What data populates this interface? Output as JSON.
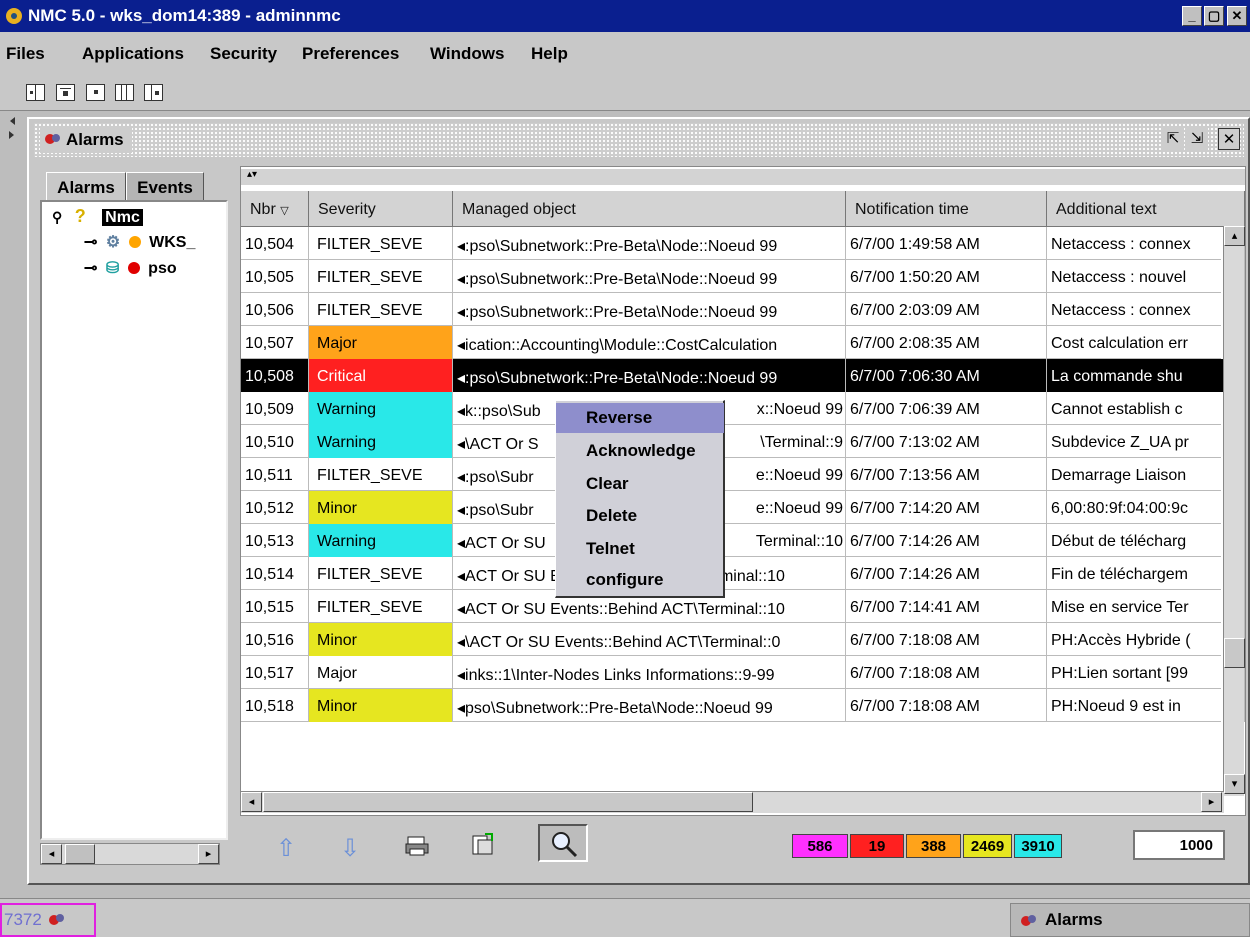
{
  "window": {
    "title": "NMC 5.0 - wks_dom14:389 - adminnmc",
    "controls": [
      "_",
      "▢",
      "✕"
    ]
  },
  "menu": [
    "Files",
    "Applications",
    "Security",
    "Preferences",
    "Windows",
    "Help"
  ],
  "frame": {
    "title": "Alarms"
  },
  "left_tabs": [
    "Alarms",
    "Events"
  ],
  "tree": [
    {
      "label": "Nmc",
      "color": "#000000"
    },
    {
      "label": "WKS_",
      "color": "#ffa500"
    },
    {
      "label": "pso",
      "color": "#e00000"
    }
  ],
  "table": {
    "columns": [
      "Nbr",
      "Severity",
      "Managed object",
      "Notification time",
      "Additional text"
    ],
    "rows": [
      [
        "10,504",
        "FILTER_SEVE",
        "◂:pso\\Subnetwork::Pre-Beta\\Node::Noeud 99",
        "6/7/00 1:49:58 AM",
        "Netaccess : connex"
      ],
      [
        "10,505",
        "FILTER_SEVE",
        "◂:pso\\Subnetwork::Pre-Beta\\Node::Noeud 99",
        "6/7/00 1:50:20 AM",
        "Netaccess : nouvel"
      ],
      [
        "10,506",
        "FILTER_SEVE",
        "◂:pso\\Subnetwork::Pre-Beta\\Node::Noeud 99",
        "6/7/00 2:03:09 AM",
        "Netaccess : connex"
      ],
      [
        "10,507",
        "Major",
        "◂ication::Accounting\\Module::CostCalculation",
        "6/7/00 2:08:35 AM",
        "Cost calculation err"
      ],
      [
        "10,508",
        "Critical",
        "◂:pso\\Subnetwork::Pre-Beta\\Node::Noeud 99",
        "6/7/00 7:06:30 AM",
        "La commande shu"
      ],
      [
        "10,509",
        "Warning",
        "◂k::pso\\Sub",
        "6/7/00 7:06:39 AM",
        "Cannot establish c"
      ],
      [
        "10,510",
        "Warning",
        "◂\\ACT Or S",
        "6/7/00 7:13:02 AM",
        "Subdevice Z_UA pr"
      ],
      [
        "10,511",
        "FILTER_SEVE",
        "◂:pso\\Subr",
        "6/7/00 7:13:56 AM",
        "Demarrage Liaison"
      ],
      [
        "10,512",
        "Minor",
        "◂:pso\\Subr",
        "6/7/00 7:14:20 AM",
        "6,00:80:9f:04:00:9c"
      ],
      [
        "10,513",
        "Warning",
        "◂ACT Or SU",
        "6/7/00 7:14:26 AM",
        "Début de télécharg"
      ],
      [
        "10,514",
        "FILTER_SEVE",
        "◂ACT Or SU Events::Behind ACT\\Terminal::10",
        "6/7/00 7:14:26 AM",
        "Fin de téléchargem"
      ],
      [
        "10,515",
        "FILTER_SEVE",
        "◂ACT Or SU Events::Behind ACT\\Terminal::10",
        "6/7/00 7:14:41 AM",
        "Mise en service Ter"
      ],
      [
        "10,516",
        "Minor",
        "◂\\ACT Or SU Events::Behind ACT\\Terminal::0",
        "6/7/00 7:18:08 AM",
        "PH:Accès Hybride ("
      ],
      [
        "10,517",
        "Major",
        "◂inks::1\\Inter-Nodes Links Informations::9-99",
        "6/7/00 7:18:08 AM",
        "PH:Lien sortant [99"
      ],
      [
        "10,518",
        "Minor",
        "◂pso\\Subnetwork::Pre-Beta\\Node::Noeud 99",
        "6/7/00 7:18:08 AM",
        "PH:Noeud 9 est in"
      ]
    ],
    "row_bg": [
      "",
      "",
      "",
      "#ffa31a",
      "#ff2020",
      "#29e8e8",
      "#29e8e8",
      "",
      "#e6e620",
      "#29e8e8",
      "",
      "",
      "#e6e620",
      "",
      "#e6e620"
    ],
    "selected_row": 4
  },
  "cell_tail": {
    "r5": "x::Noeud 99",
    "r6": "\\Terminal::9",
    "r7": "e::Noeud 99",
    "r8": "e::Noeud 99",
    "r9": "Terminal::10"
  },
  "context_menu": [
    "Reverse",
    "Acknowledge",
    "Clear",
    "Delete",
    "Telnet",
    "configure"
  ],
  "counters": [
    {
      "value": "586",
      "color": "#ff30ff"
    },
    {
      "value": "19",
      "color": "#ff2020"
    },
    {
      "value": "388",
      "color": "#ffa31a"
    },
    {
      "value": "2469",
      "color": "#e6e620"
    },
    {
      "value": "3910",
      "color": "#29e8e8"
    }
  ],
  "count_box": "1000",
  "status": {
    "count": "7372",
    "task": "Alarms"
  }
}
